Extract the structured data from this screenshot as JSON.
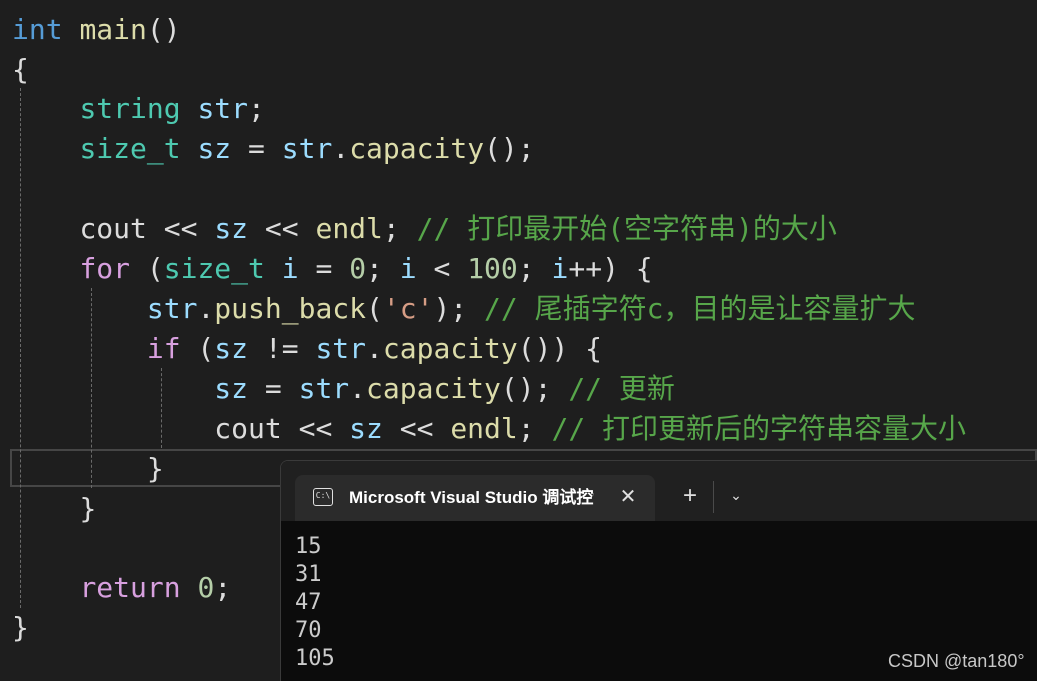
{
  "editor": {
    "lines": [
      [
        {
          "t": "int",
          "c": "kw"
        },
        {
          "t": " ",
          "c": "p"
        },
        {
          "t": "main",
          "c": "fn"
        },
        {
          "t": "()",
          "c": "p"
        }
      ],
      [
        {
          "t": "{",
          "c": "p"
        }
      ],
      [
        {
          "t": "    ",
          "c": "p"
        },
        {
          "t": "string",
          "c": "type"
        },
        {
          "t": " ",
          "c": "p"
        },
        {
          "t": "str",
          "c": "var"
        },
        {
          "t": ";",
          "c": "p"
        }
      ],
      [
        {
          "t": "    ",
          "c": "p"
        },
        {
          "t": "size_t",
          "c": "type"
        },
        {
          "t": " ",
          "c": "p"
        },
        {
          "t": "sz",
          "c": "var"
        },
        {
          "t": " = ",
          "c": "p"
        },
        {
          "t": "str",
          "c": "var"
        },
        {
          "t": ".",
          "c": "p"
        },
        {
          "t": "capacity",
          "c": "fn"
        },
        {
          "t": "();",
          "c": "p"
        }
      ],
      [],
      [
        {
          "t": "    ",
          "c": "p"
        },
        {
          "t": "cout",
          "c": "ident"
        },
        {
          "t": " << ",
          "c": "p"
        },
        {
          "t": "sz",
          "c": "var"
        },
        {
          "t": " << ",
          "c": "p"
        },
        {
          "t": "endl",
          "c": "fn"
        },
        {
          "t": "; ",
          "c": "p"
        },
        {
          "t": "// 打印最开始(空字符串)的大小",
          "c": "cmt"
        }
      ],
      [
        {
          "t": "    ",
          "c": "p"
        },
        {
          "t": "for",
          "c": "ctl"
        },
        {
          "t": " (",
          "c": "p"
        },
        {
          "t": "size_t",
          "c": "type"
        },
        {
          "t": " ",
          "c": "p"
        },
        {
          "t": "i",
          "c": "var"
        },
        {
          "t": " = ",
          "c": "p"
        },
        {
          "t": "0",
          "c": "num"
        },
        {
          "t": "; ",
          "c": "p"
        },
        {
          "t": "i",
          "c": "var"
        },
        {
          "t": " < ",
          "c": "p"
        },
        {
          "t": "100",
          "c": "num"
        },
        {
          "t": "; ",
          "c": "p"
        },
        {
          "t": "i",
          "c": "var"
        },
        {
          "t": "++) {",
          "c": "p"
        }
      ],
      [
        {
          "t": "        ",
          "c": "p"
        },
        {
          "t": "str",
          "c": "var"
        },
        {
          "t": ".",
          "c": "p"
        },
        {
          "t": "push_back",
          "c": "fn"
        },
        {
          "t": "(",
          "c": "p"
        },
        {
          "t": "'c'",
          "c": "str"
        },
        {
          "t": "); ",
          "c": "p"
        },
        {
          "t": "// 尾插字符c，目的是让容量扩大",
          "c": "cmt"
        }
      ],
      [
        {
          "t": "        ",
          "c": "p"
        },
        {
          "t": "if",
          "c": "ctl"
        },
        {
          "t": " (",
          "c": "p"
        },
        {
          "t": "sz",
          "c": "var"
        },
        {
          "t": " != ",
          "c": "p"
        },
        {
          "t": "str",
          "c": "var"
        },
        {
          "t": ".",
          "c": "p"
        },
        {
          "t": "capacity",
          "c": "fn"
        },
        {
          "t": "()) {",
          "c": "p"
        }
      ],
      [
        {
          "t": "            ",
          "c": "p"
        },
        {
          "t": "sz",
          "c": "var"
        },
        {
          "t": " = ",
          "c": "p"
        },
        {
          "t": "str",
          "c": "var"
        },
        {
          "t": ".",
          "c": "p"
        },
        {
          "t": "capacity",
          "c": "fn"
        },
        {
          "t": "(); ",
          "c": "p"
        },
        {
          "t": "// 更新",
          "c": "cmt"
        }
      ],
      [
        {
          "t": "            ",
          "c": "p"
        },
        {
          "t": "cout",
          "c": "ident"
        },
        {
          "t": " << ",
          "c": "p"
        },
        {
          "t": "sz",
          "c": "var"
        },
        {
          "t": " << ",
          "c": "p"
        },
        {
          "t": "endl",
          "c": "fn"
        },
        {
          "t": "; ",
          "c": "p"
        },
        {
          "t": "// 打印更新后的字符串容量大小",
          "c": "cmt"
        }
      ],
      [
        {
          "t": "        ",
          "c": "p"
        },
        {
          "t": "}",
          "c": "p"
        }
      ],
      [
        {
          "t": "    ",
          "c": "p"
        },
        {
          "t": "}",
          "c": "p"
        }
      ],
      [],
      [
        {
          "t": "    ",
          "c": "p"
        },
        {
          "t": "return",
          "c": "ctl"
        },
        {
          "t": " ",
          "c": "p"
        },
        {
          "t": "0",
          "c": "num"
        },
        {
          "t": ";",
          "c": "p"
        }
      ],
      [
        {
          "t": "}",
          "c": "p"
        }
      ]
    ]
  },
  "terminal": {
    "tab_icon": "console-icon",
    "tab_icon_glyph": "C:\\",
    "tab_title": "Microsoft Visual Studio 调试控制台",
    "close_glyph": "✕",
    "new_tab_glyph": "+",
    "dropdown_glyph": "⌄",
    "output": [
      "15",
      "31",
      "47",
      "70",
      "105"
    ]
  },
  "watermark": "CSDN @tan180°",
  "colors": {
    "editor_bg": "#1e1e1e",
    "keyword": "#569cd6",
    "control": "#d8a0df",
    "type": "#4ec9b0",
    "function": "#dcdcaa",
    "variable": "#9cdcfe",
    "number": "#b5cea8",
    "string": "#d69d85",
    "comment": "#57a64a",
    "terminal_bg": "#0c0c0c",
    "terminal_titlebar": "#202020"
  }
}
